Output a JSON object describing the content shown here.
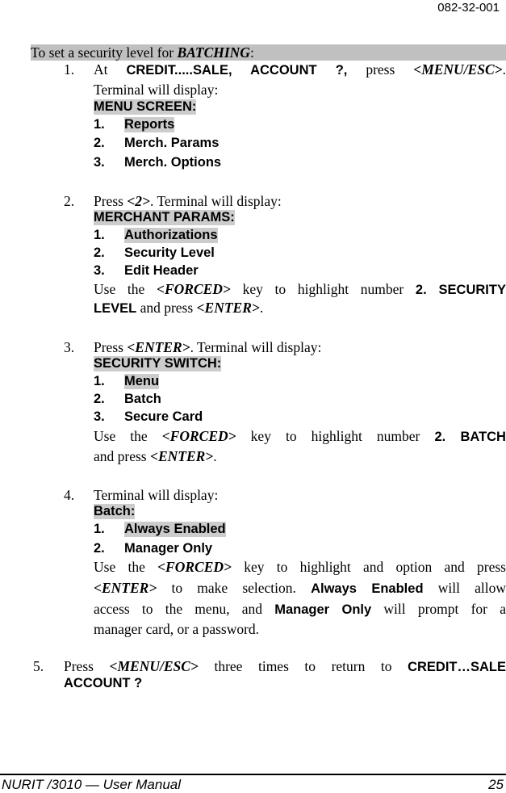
{
  "header": {
    "doc_id": "082-32-001"
  },
  "section": {
    "title_prefix": "To set a security level for ",
    "title_emph": "BATCHING",
    "title_suffix": ":"
  },
  "steps": [
    {
      "number": "1.",
      "line1": {
        "t1": "At ",
        "b1": "CREDIT.....SALE, ACCOUNT ?,",
        "t2": " press ",
        "k1": "<MENU/ESC>",
        "t3": "."
      },
      "line2": "Terminal will display:",
      "screen_title": "MENU SCREEN:",
      "items": [
        {
          "num": "1.",
          "label": "Reports"
        },
        {
          "num": "2.",
          "label": "Merch. Params"
        },
        {
          "num": "3.",
          "label": "Merch. Options"
        }
      ]
    },
    {
      "number": "2.",
      "line1": {
        "t1": "Press ",
        "k1": "<2>",
        "t2": ". Terminal will display:"
      },
      "screen_title": "MERCHANT PARAMS:",
      "items": [
        {
          "num": "1.",
          "label": "Authorizations"
        },
        {
          "num": "2.",
          "label": "Security Level"
        },
        {
          "num": "3.",
          "label": "Edit Header"
        }
      ],
      "note": {
        "t1": "Use the ",
        "k1": "<FORCED>",
        "t2": " key to highlight number ",
        "b1": "2. SECURITY",
        "b2": "LEVEL",
        "t3": " and press ",
        "k2": "<ENTER>",
        "t4": "."
      }
    },
    {
      "number": "3.",
      "line1": {
        "t1": "Press ",
        "k1": "<ENTER>",
        "t2": ". Terminal will display:"
      },
      "screen_title": "SECURITY SWITCH:",
      "items": [
        {
          "num": "1.",
          "label": "Menu"
        },
        {
          "num": "2.",
          "label": "Batch"
        },
        {
          "num": "3.",
          "label": "Secure Card"
        }
      ],
      "note": {
        "t1": "Use the ",
        "k1": "<FORCED>",
        "t2": " key to highlight number ",
        "b1": "2. BATCH",
        "t3": "and press ",
        "k2": "<ENTER>",
        "t4": "."
      }
    },
    {
      "number": "4.",
      "line1": {
        "t1": "Terminal will display:"
      },
      "screen_title": "Batch:",
      "items": [
        {
          "num": "1.",
          "label": "Always Enabled"
        },
        {
          "num": "2.",
          "label": "Manager Only"
        }
      ],
      "note": {
        "t1": "Use the ",
        "k1": "<FORCED>",
        "t2": " key to highlight and option and press",
        "k2": "<ENTER>",
        "t3": " to make selection.  ",
        "b1": "Always Enabled",
        "t4": " will allow",
        "t5": "access to the menu, and ",
        "b2": "Manager Only",
        "t6": " will prompt for a",
        "t7": "manager card, or a password."
      }
    },
    {
      "number": "5.",
      "line1": {
        "t1": "Press ",
        "k1": "<MENU/ESC>",
        "t2": " three times to return to ",
        "b1": "CREDIT…SALE"
      },
      "line2_bold": "ACCOUNT ?"
    }
  ],
  "footer": {
    "left": "NURIT /3010 — User Manual",
    "page": "25"
  }
}
